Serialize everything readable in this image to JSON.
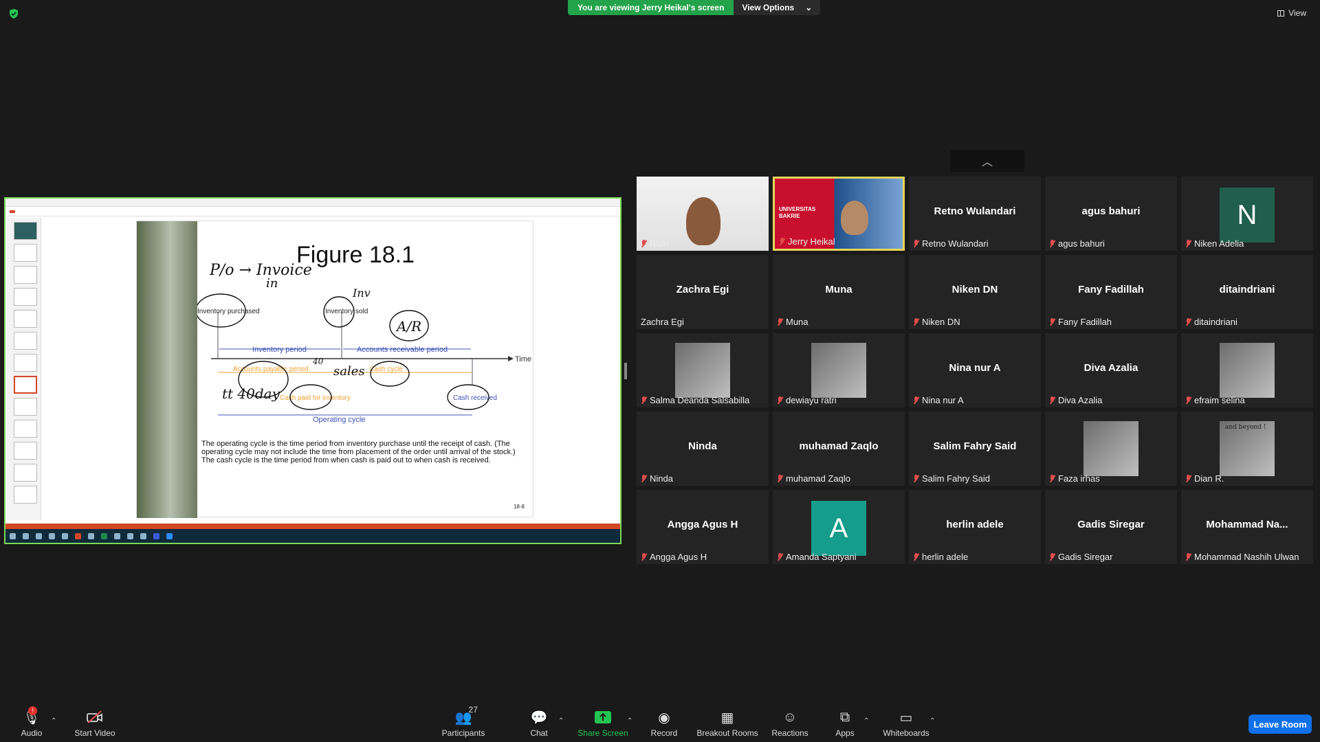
{
  "top": {
    "viewing": "You are viewing Jerry Heikal's screen",
    "view_options": "View Options",
    "view": "View"
  },
  "slide": {
    "title": "Figure 18.1",
    "caption": "The operating cycle is the time period from inventory purchase until the receipt of cash. (The operating cycle may not include the time from placement of the order until arrival of the stock.) The cash cycle is the time period from when cash is paid out to when cash is received.",
    "page": "18-8",
    "labels": {
      "inv_purchased": "Inventory purchased",
      "inv_sold": "Inventory sold",
      "inv_period": "Inventory period",
      "ar_period": "Accounts receivable period",
      "time": "Time",
      "ap_period": "Accounts payable period",
      "cash_cycle": "Cash cycle",
      "cash_paid": "Cash paid for inventory",
      "cash_received": "Cash received",
      "operating_cycle": "Operating cycle"
    },
    "ink": {
      "note1": "P/o → Invoice",
      "note2": "in",
      "note3": "Inv",
      "note4": "A/R",
      "note5": "40",
      "note6": "sales",
      "note7": "tt 40day"
    }
  },
  "participants": [
    {
      "name": "Riski",
      "type": "video",
      "muted": true
    },
    {
      "name": "Jerry Heikal",
      "type": "video",
      "muted": true,
      "active": true,
      "banner": "UNIVERSITAS BAKRIE"
    },
    {
      "name": "Retno Wulandari",
      "display": "Retno Wulandari",
      "muted": true
    },
    {
      "name": "agus bahuri",
      "display": "agus bahuri",
      "muted": true
    },
    {
      "name": "Niken Adelia",
      "avatar": "N",
      "color": "#1f5f4b",
      "muted": true
    },
    {
      "name": "Zachra Egi",
      "display": "Zachra Egi",
      "muted": false
    },
    {
      "name": "Muna",
      "display": "Muna",
      "muted": true
    },
    {
      "name": "Niken DN",
      "display": "Niken DN",
      "muted": true
    },
    {
      "name": "Fany Fadillah",
      "display": "Fany Fadillah",
      "muted": true
    },
    {
      "name": "ditaindriani",
      "display": "ditaindriani",
      "muted": true
    },
    {
      "name": "Salma Deanda Salsabilla",
      "type": "photo",
      "muted": true
    },
    {
      "name": "dewiayu ratri",
      "type": "photo",
      "muted": true
    },
    {
      "name": "Nina nur A",
      "display": "Nina nur A",
      "muted": true
    },
    {
      "name": "Diva Azalia",
      "display": "Diva Azalia",
      "muted": true
    },
    {
      "name": "efraim selina",
      "type": "photo",
      "muted": true
    },
    {
      "name": "Ninda",
      "display": "Ninda",
      "muted": true
    },
    {
      "name": "muhamad Zaqlo",
      "display": "muhamad Zaqlo",
      "muted": true
    },
    {
      "name": "Salim Fahry Said",
      "display": "Salim Fahry Said",
      "muted": true
    },
    {
      "name": "Faza irhas",
      "type": "photo",
      "muted": true
    },
    {
      "name": "Dian R.",
      "type": "photo",
      "muted": true,
      "photo_text": "and beyond !"
    },
    {
      "name": "Angga Agus H",
      "display": "Angga Agus H",
      "muted": true
    },
    {
      "name": "Amanda Saptyani",
      "avatar": "A",
      "color": "#159c8a",
      "muted": true
    },
    {
      "name": "herlin adele",
      "display": "herlin adele",
      "muted": true
    },
    {
      "name": "Gadis Siregar",
      "display": "Gadis Siregar",
      "muted": true
    },
    {
      "name": "Mohammad Nashih Ulwan",
      "display": "Mohammad  Na...",
      "muted": true
    }
  ],
  "toolbar": {
    "audio": "Audio",
    "audio_badge": "!",
    "start_video": "Start Video",
    "participants": "Participants",
    "participants_count": "27",
    "chat": "Chat",
    "share_screen": "Share Screen",
    "record": "Record",
    "breakout": "Breakout Rooms",
    "reactions": "Reactions",
    "apps": "Apps",
    "whiteboards": "Whiteboards",
    "leave": "Leave Room"
  },
  "colors": {
    "share_border": "#7ed957",
    "viewing_green": "#23a34a",
    "leave_blue": "#0e71eb",
    "active_speaker": "#e5d75a"
  }
}
